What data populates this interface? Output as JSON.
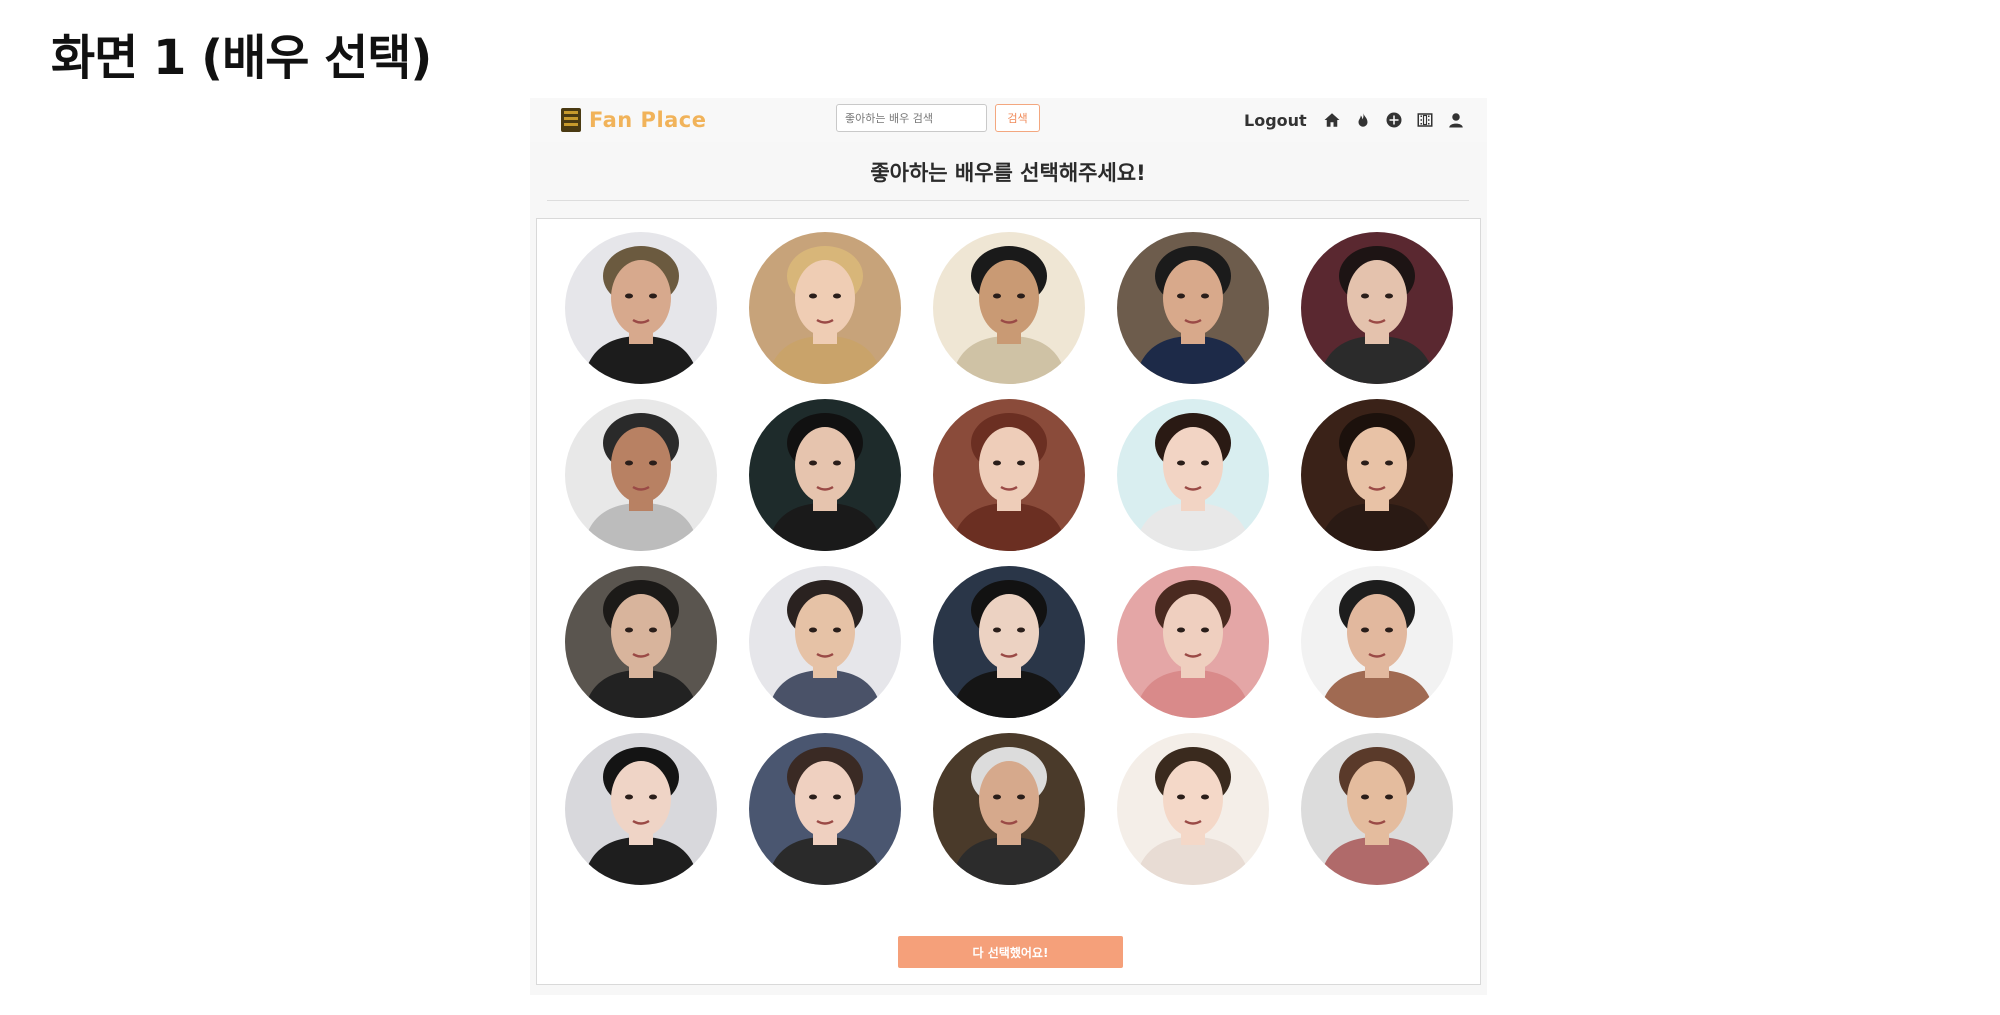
{
  "slide": {
    "title": "화면 1 (배우 선택)"
  },
  "header": {
    "logo_text": "Fan Place",
    "search_placeholder": "좋아하는 배우 검색",
    "search_button": "검색",
    "logout": "Logout",
    "icons": [
      "home-icon",
      "fire-icon",
      "plus-circle-icon",
      "film-icon",
      "user-icon"
    ]
  },
  "main": {
    "heading": "좋아하는 배우를 선택해주세요!",
    "done_button": "다 선택했어요!"
  },
  "colors": {
    "accent": "#f5a07a",
    "logo": "#f1b35a",
    "search_button_border": "#f3a77f"
  },
  "actors": [
    {
      "bg": "#e6e6ea",
      "hair": "#6b5a3f",
      "skin": "#d7a98d",
      "cloth": "#1c1c1c"
    },
    {
      "bg": "#c7a37a",
      "hair": "#d8b679",
      "skin": "#efcdb4",
      "cloth": "#c9a36a"
    },
    {
      "bg": "#efe6d4",
      "hair": "#1a1a1a",
      "skin": "#c99a74",
      "cloth": "#cfc2a5"
    },
    {
      "bg": "#6d5c4c",
      "hair": "#1b1b1b",
      "skin": "#d8a98b",
      "cloth": "#1d2a48"
    },
    {
      "bg": "#5a2830",
      "hair": "#1d1414",
      "skin": "#e4c2ad",
      "cloth": "#2b2b2b"
    },
    {
      "bg": "#e8e8e8",
      "hair": "#2a2a2a",
      "skin": "#b88163",
      "cloth": "#bcbcbc"
    },
    {
      "bg": "#1e2b2b",
      "hair": "#111111",
      "skin": "#e6c4ae",
      "cloth": "#1a1a1a"
    },
    {
      "bg": "#8a4b3a",
      "hair": "#6b2f22",
      "skin": "#eecdb9",
      "cloth": "#6b2f22"
    },
    {
      "bg": "#d9eef0",
      "hair": "#2a1a14",
      "skin": "#f2d4c4",
      "cloth": "#e8e8e8"
    },
    {
      "bg": "#3a2218",
      "hair": "#1c110c",
      "skin": "#e8c2a6",
      "cloth": "#2a1a14"
    },
    {
      "bg": "#5a554f",
      "hair": "#1c1a18",
      "skin": "#d8b49c",
      "cloth": "#222222"
    },
    {
      "bg": "#e6e6ea",
      "hair": "#2a2220",
      "skin": "#e6c2a6",
      "cloth": "#4a5268"
    },
    {
      "bg": "#2a3648",
      "hair": "#121212",
      "skin": "#ecd2c2",
      "cloth": "#151515"
    },
    {
      "bg": "#e4a6a6",
      "hair": "#4a2a20",
      "skin": "#efcfbf",
      "cloth": "#d98a8a"
    },
    {
      "bg": "#f2f2f2",
      "hair": "#1d1d1d",
      "skin": "#e2b89e",
      "cloth": "#a06a52"
    },
    {
      "bg": "#d8d8dc",
      "hair": "#141414",
      "skin": "#efd4c6",
      "cloth": "#1e1e1e"
    },
    {
      "bg": "#4a5670",
      "hair": "#3a2a24",
      "skin": "#efd0c0",
      "cloth": "#2a2a2a"
    },
    {
      "bg": "#4a3a2a",
      "hair": "#dcdcdc",
      "skin": "#d6a98c",
      "cloth": "#2c2c2c"
    },
    {
      "bg": "#f4eee8",
      "hair": "#3a2a1e",
      "skin": "#f4d8c8",
      "cloth": "#e8dcd4"
    },
    {
      "bg": "#dcdcdc",
      "hair": "#5a3a2a",
      "skin": "#e4bc9e",
      "cloth": "#b06a6a"
    }
  ]
}
